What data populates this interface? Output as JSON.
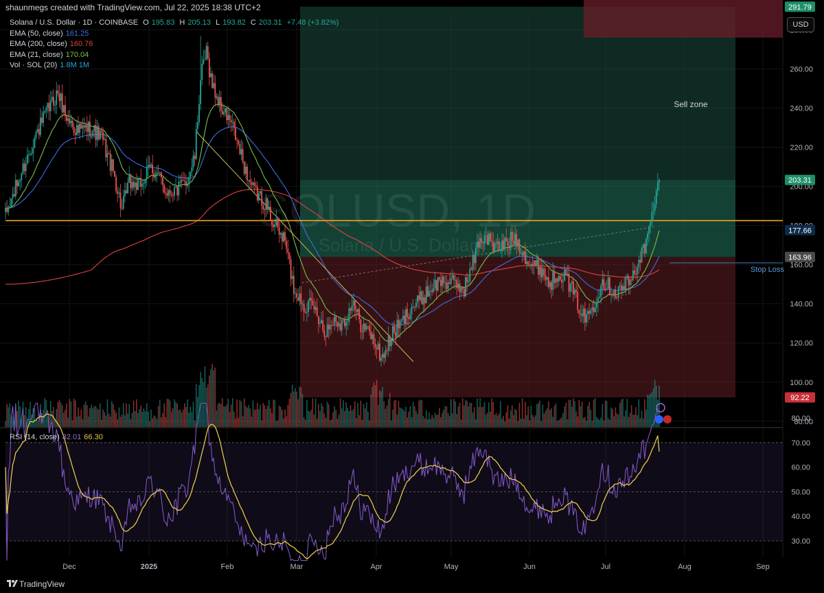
{
  "header": {
    "attribution": "shaunmegs created with TradingView.com, Jul 22, 2025 18:38 UTC+2"
  },
  "legend": {
    "symbol": "Solana / U.S. Dollar · 1D · COINBASE",
    "ohlc": [
      {
        "k": "O",
        "v": "195.83"
      },
      {
        "k": "H",
        "v": "205.13"
      },
      {
        "k": "L",
        "v": "193.82"
      },
      {
        "k": "C",
        "v": "203.31"
      }
    ],
    "change": "+7.48 (+3.82%)",
    "indicators": [
      {
        "label": "EMA (50, close)",
        "value": "161.25",
        "color": "#3d6fe0"
      },
      {
        "label": "EMA (200, close)",
        "value": "160.76",
        "color": "#e0443e"
      },
      {
        "label": "EMA (21, close)",
        "value": "170.04",
        "color": "#7cc04a"
      },
      {
        "label": "Vol · SOL (20)",
        "value": "1.8M  1M",
        "color": "#26a6d9"
      }
    ]
  },
  "rsi_legend": {
    "label": "RSI (14, close)",
    "value": "82.01",
    "ma": "66.30"
  },
  "currency_button": "USD",
  "watermark": {
    "symbol": "SOLUSD, 1D",
    "name": "Solana / U.S. Dollar"
  },
  "annotations": {
    "sell_zone": "Sell zone",
    "stop_loss": "Stop Loss"
  },
  "price_tags": [
    {
      "text": "291.79",
      "value": 291.79,
      "bg": "#1f8f6a"
    },
    {
      "text": "203.31",
      "value": 203.31,
      "bg": "#1f8f6a"
    },
    {
      "text": "177.66",
      "value": 177.66,
      "bg": "#0d2a4a"
    },
    {
      "text": "163.96",
      "value": 163.96,
      "bg": "#4a4a4a"
    },
    {
      "text": "92.22",
      "value": 92.22,
      "bg": "#c8313a"
    }
  ],
  "footer": {
    "brand": "TradingView"
  },
  "colors": {
    "up": "#26a69a",
    "down": "#ef5350",
    "ema50": "#3d6fe0",
    "ema200": "#e0443e",
    "ema21": "#7cc04a",
    "hline": "#f5a623",
    "trendline": "#c8b85a",
    "rsi": "#7e57c2",
    "rsi_ma": "#e6c84a"
  },
  "chart_data": [
    {
      "type": "candlestick",
      "title": "Solana / U.S. Dollar · 1D · COINBASE",
      "y_axis": {
        "side": "right",
        "ylim": [
          67,
          348
        ],
        "ticks": [
          80,
          100,
          120,
          140,
          160,
          180,
          200,
          220,
          240,
          260,
          280,
          300,
          320,
          340
        ]
      },
      "x_axis": {
        "labels": [
          "Dec",
          "2025",
          "Feb",
          "Mar",
          "Apr",
          "May",
          "Jun",
          "Jul",
          "Aug",
          "Sep"
        ]
      },
      "anchors": [
        {
          "x": 0,
          "p": 185
        },
        {
          "x": 10,
          "p": 205
        },
        {
          "x": 20,
          "p": 225
        },
        {
          "x": 30,
          "p": 240
        },
        {
          "x": 36,
          "p": 248
        },
        {
          "x": 42,
          "p": 235
        },
        {
          "x": 50,
          "p": 228
        },
        {
          "x": 58,
          "p": 230
        },
        {
          "x": 66,
          "p": 225
        },
        {
          "x": 75,
          "p": 205
        },
        {
          "x": 80,
          "p": 188
        },
        {
          "x": 85,
          "p": 202
        },
        {
          "x": 92,
          "p": 200
        },
        {
          "x": 100,
          "p": 210
        },
        {
          "x": 105,
          "p": 205
        },
        {
          "x": 110,
          "p": 198
        },
        {
          "x": 118,
          "p": 198
        },
        {
          "x": 124,
          "p": 202
        },
        {
          "x": 130,
          "p": 215
        },
        {
          "x": 134,
          "p": 255
        },
        {
          "x": 138,
          "p": 268
        },
        {
          "x": 142,
          "p": 252
        },
        {
          "x": 148,
          "p": 240
        },
        {
          "x": 155,
          "p": 232
        },
        {
          "x": 160,
          "p": 220
        },
        {
          "x": 165,
          "p": 208
        },
        {
          "x": 170,
          "p": 198
        },
        {
          "x": 178,
          "p": 192
        },
        {
          "x": 185,
          "p": 180
        },
        {
          "x": 192,
          "p": 172
        },
        {
          "x": 198,
          "p": 148
        },
        {
          "x": 205,
          "p": 140
        },
        {
          "x": 212,
          "p": 138
        },
        {
          "x": 220,
          "p": 126
        },
        {
          "x": 226,
          "p": 132
        },
        {
          "x": 232,
          "p": 130
        },
        {
          "x": 238,
          "p": 140
        },
        {
          "x": 244,
          "p": 130
        },
        {
          "x": 250,
          "p": 125
        },
        {
          "x": 254,
          "p": 120
        },
        {
          "x": 258,
          "p": 112
        },
        {
          "x": 262,
          "p": 118
        },
        {
          "x": 266,
          "p": 125
        },
        {
          "x": 272,
          "p": 130
        },
        {
          "x": 278,
          "p": 138
        },
        {
          "x": 285,
          "p": 142
        },
        {
          "x": 292,
          "p": 148
        },
        {
          "x": 300,
          "p": 152
        },
        {
          "x": 308,
          "p": 150
        },
        {
          "x": 315,
          "p": 148
        },
        {
          "x": 320,
          "p": 158
        },
        {
          "x": 325,
          "p": 172
        },
        {
          "x": 330,
          "p": 175
        },
        {
          "x": 336,
          "p": 168
        },
        {
          "x": 342,
          "p": 170
        },
        {
          "x": 350,
          "p": 174
        },
        {
          "x": 355,
          "p": 168
        },
        {
          "x": 360,
          "p": 160
        },
        {
          "x": 368,
          "p": 158
        },
        {
          "x": 374,
          "p": 150
        },
        {
          "x": 380,
          "p": 157
        },
        {
          "x": 386,
          "p": 152
        },
        {
          "x": 392,
          "p": 142
        },
        {
          "x": 398,
          "p": 132
        },
        {
          "x": 404,
          "p": 140
        },
        {
          "x": 410,
          "p": 152
        },
        {
          "x": 416,
          "p": 148
        },
        {
          "x": 420,
          "p": 146
        },
        {
          "x": 426,
          "p": 150
        },
        {
          "x": 430,
          "p": 152
        },
        {
          "x": 436,
          "p": 165
        },
        {
          "x": 440,
          "p": 170
        },
        {
          "x": 444,
          "p": 185
        },
        {
          "x": 447,
          "p": 195
        },
        {
          "x": 449,
          "p": 203.31
        }
      ],
      "horizontal_lines": [
        {
          "price": 182.5,
          "color": "#f5a623"
        }
      ],
      "zones": [
        {
          "name": "Sell zone",
          "price_from": 276,
          "price_to": 301
        },
        {
          "name": "target",
          "price_from": 163.96,
          "price_to": 291.79
        },
        {
          "name": "entry-profit",
          "price_from": 163.96,
          "price_to": 203.31
        },
        {
          "name": "risk",
          "price_from": 92.22,
          "price_to": 163.96
        }
      ]
    },
    {
      "type": "line",
      "title": "RSI (14, close)",
      "y_axis": {
        "side": "right",
        "ticks": [
          30,
          40,
          50,
          60,
          70,
          80
        ],
        "bands": [
          30,
          50,
          70
        ]
      },
      "series": [
        {
          "name": "RSI",
          "last": 82.01
        },
        {
          "name": "RSI MA",
          "last": 66.3
        }
      ]
    }
  ]
}
